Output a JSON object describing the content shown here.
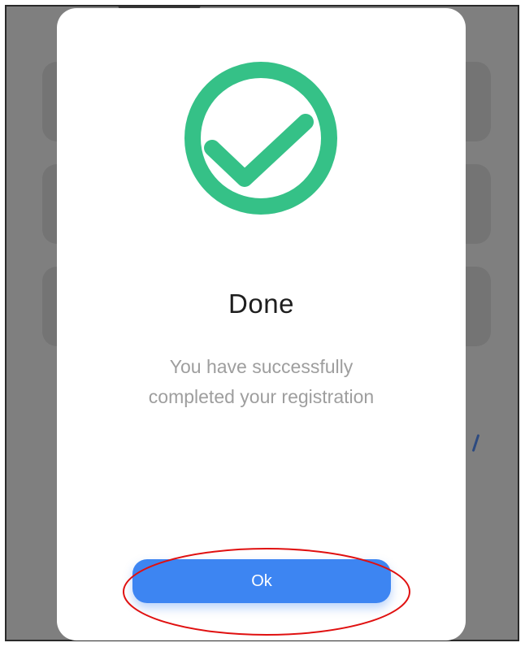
{
  "dialog": {
    "title": "Done",
    "message": "You have  successfully\ncompleted your registration",
    "ok_label": "Ok",
    "icon": "checkmark-circle-icon"
  },
  "colors": {
    "success": "#35c187",
    "primary_button": "#3d85f2",
    "annotation": "#e01010",
    "overlay": "#7f7f7f"
  }
}
